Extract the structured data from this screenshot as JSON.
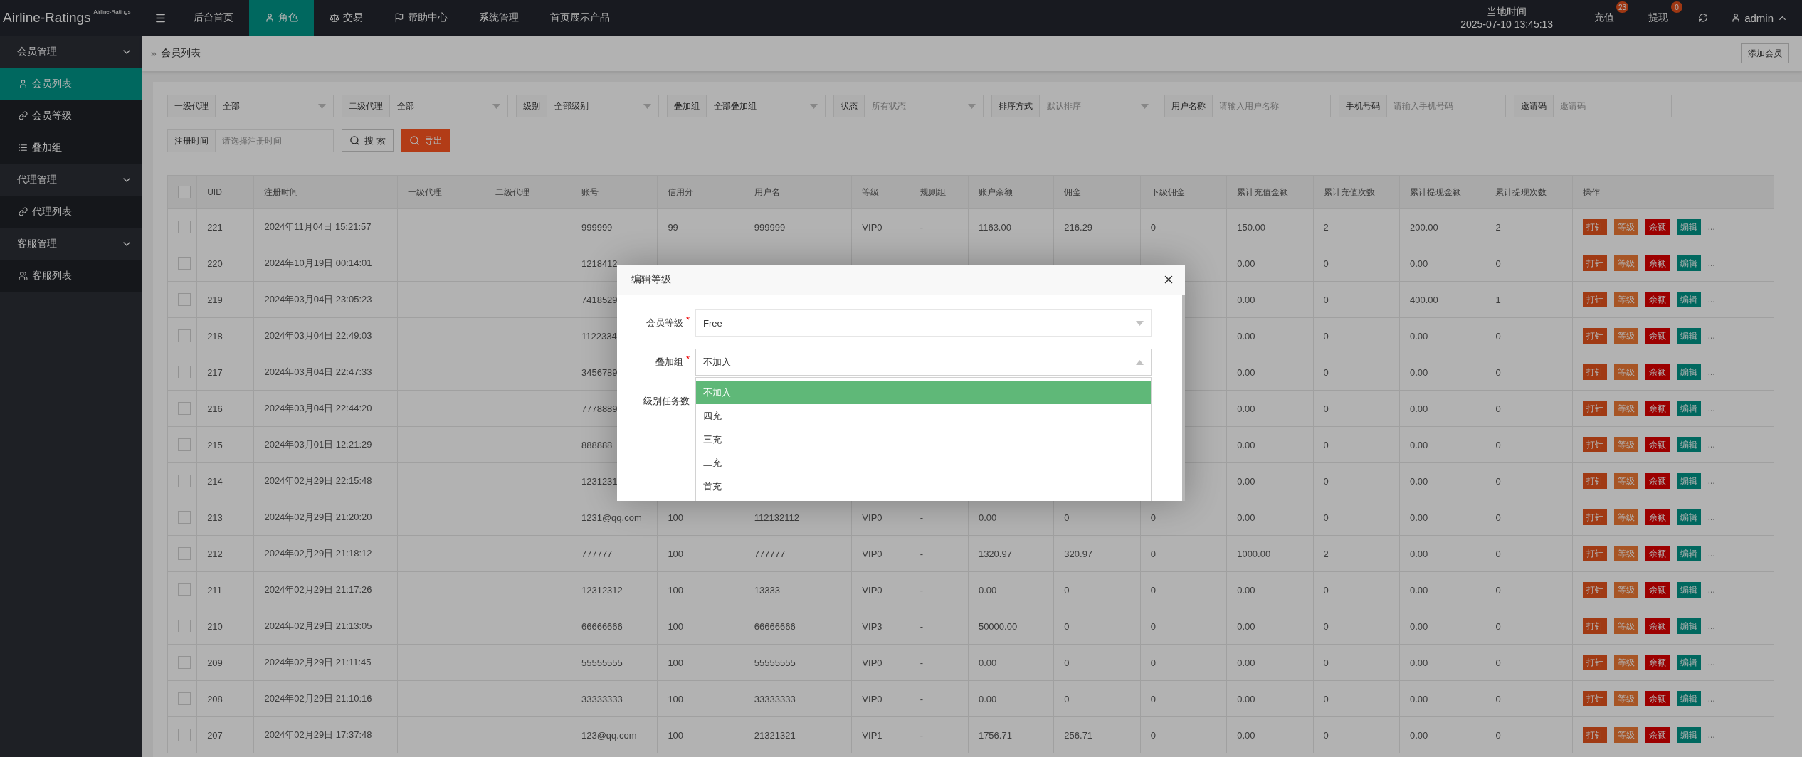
{
  "header": {
    "logo": "Airline-Ratings",
    "logo_sup": "Airline-Ratings",
    "nav": [
      {
        "label": "后台首页",
        "selected": false
      },
      {
        "label": "角色",
        "selected": true
      },
      {
        "label": "交易",
        "selected": false
      },
      {
        "label": "帮助中心",
        "selected": false
      },
      {
        "label": "系统管理",
        "selected": false
      },
      {
        "label": "首页展示产品",
        "selected": false
      }
    ],
    "clock": {
      "label": "当地时间",
      "value": "2025-07-10 13:45:13"
    },
    "counters": [
      {
        "label": "充值",
        "badge": "23"
      },
      {
        "label": "提现",
        "badge": "0"
      }
    ],
    "user": {
      "name": "admin",
      "expanded": true
    }
  },
  "sidebar": {
    "groups": [
      {
        "label": "会员管理",
        "expanded": true,
        "items": [
          {
            "label": "会员列表",
            "selected": true
          },
          {
            "label": "会员等级",
            "selected": false
          },
          {
            "label": "叠加组",
            "selected": false
          }
        ]
      },
      {
        "label": "代理管理",
        "expanded": true,
        "items": [
          {
            "label": "代理列表",
            "selected": false
          }
        ]
      },
      {
        "label": "客服管理",
        "expanded": true,
        "items": [
          {
            "label": "客服列表",
            "selected": false
          }
        ]
      }
    ]
  },
  "breadcrumb": {
    "separator": "»",
    "current": "会员列表",
    "add_button": "添加会员"
  },
  "filters": [
    {
      "kind": "select",
      "label": "一级代理",
      "value": "全部"
    },
    {
      "kind": "select",
      "label": "二级代理",
      "value": "全部"
    },
    {
      "kind": "select",
      "label": "级别",
      "value": "全部级别"
    },
    {
      "kind": "select",
      "label": "叠加组",
      "value": "全部叠加组"
    },
    {
      "kind": "select",
      "label": "状态",
      "placeholder": "所有状态"
    },
    {
      "kind": "select",
      "label": "排序方式",
      "placeholder": "默认排序"
    },
    {
      "kind": "input",
      "label": "用户名称",
      "placeholder": "请输入用户名称"
    },
    {
      "kind": "input",
      "label": "手机号码",
      "placeholder": "请输入手机号码"
    },
    {
      "kind": "input",
      "label": "邀请码",
      "placeholder": "邀请码"
    },
    {
      "kind": "input",
      "label": "注册时间",
      "placeholder": "请选择注册时间"
    }
  ],
  "filter_buttons": [
    {
      "kind": "search",
      "label": "搜 索"
    },
    {
      "kind": "export",
      "label": "导出"
    }
  ],
  "table": {
    "header_checked": false,
    "columns": [
      "UID",
      "注册时间",
      "一级代理",
      "二级代理",
      "账号",
      "信用分",
      "用户名",
      "等级",
      "规则组",
      "账户余额",
      "佣金",
      "下级佣金",
      "累计充值金额",
      "累计充值次数",
      "累计提现金额",
      "累计提现次数",
      "操作"
    ],
    "rows": [
      {
        "checked": false,
        "uid": "221",
        "registered": "2024年11月04日 15:21:57",
        "account": "999999",
        "credit": "99",
        "username": "999999",
        "level": "VIP0",
        "rule_group": "-",
        "balance": "1163.00",
        "commission": "216.29",
        "sub_commission": "0",
        "recharge_total": "150.00",
        "recharge_count": "2",
        "withdraw_total": "200.00",
        "withdraw_count": "2",
        "actions": [
          {
            "kind": "punch",
            "label": "打针"
          },
          {
            "kind": "level",
            "label": "等级"
          },
          {
            "kind": "balance",
            "label": "余额"
          },
          {
            "kind": "edit",
            "label": "编辑"
          }
        ],
        "more": "..."
      },
      {
        "checked": false,
        "uid": "220",
        "registered": "2024年10月19日 00:14:01",
        "account": "1218412",
        "recharge_total": "0.00",
        "recharge_count": "0",
        "withdraw_total": "0.00",
        "withdraw_count": "0",
        "actions": [
          {
            "kind": "punch",
            "label": "打针"
          },
          {
            "kind": "level",
            "label": "等级"
          },
          {
            "kind": "balance",
            "label": "余额"
          },
          {
            "kind": "edit",
            "label": "编辑"
          }
        ],
        "more": "..."
      },
      {
        "checked": false,
        "uid": "219",
        "registered": "2024年03月04日 23:05:23",
        "account": "7418529",
        "recharge_total": "0.00",
        "recharge_count": "0",
        "withdraw_total": "400.00",
        "withdraw_count": "1",
        "actions": [
          {
            "kind": "punch",
            "label": "打针"
          },
          {
            "kind": "level",
            "label": "等级"
          },
          {
            "kind": "balance",
            "label": "余额"
          },
          {
            "kind": "edit",
            "label": "编辑"
          }
        ],
        "more": "..."
      },
      {
        "checked": false,
        "uid": "218",
        "registered": "2024年03月04日 22:49:03",
        "account": "1122334",
        "recharge_total": "0.00",
        "recharge_count": "0",
        "withdraw_total": "0.00",
        "withdraw_count": "0",
        "actions": [
          {
            "kind": "punch",
            "label": "打针"
          },
          {
            "kind": "level",
            "label": "等级"
          },
          {
            "kind": "balance",
            "label": "余额"
          },
          {
            "kind": "edit",
            "label": "编辑"
          }
        ],
        "more": "..."
      },
      {
        "checked": false,
        "uid": "217",
        "registered": "2024年03月04日 22:47:33",
        "account": "3456789",
        "recharge_total": "0.00",
        "recharge_count": "0",
        "withdraw_total": "0.00",
        "withdraw_count": "0",
        "actions": [
          {
            "kind": "punch",
            "label": "打针"
          },
          {
            "kind": "level",
            "label": "等级"
          },
          {
            "kind": "balance",
            "label": "余额"
          },
          {
            "kind": "edit",
            "label": "编辑"
          }
        ],
        "more": "..."
      },
      {
        "checked": false,
        "uid": "216",
        "registered": "2024年03月04日 22:44:20",
        "account": "7778889",
        "recharge_total": "0.00",
        "recharge_count": "0",
        "withdraw_total": "0.00",
        "withdraw_count": "0",
        "actions": [
          {
            "kind": "punch",
            "label": "打针"
          },
          {
            "kind": "level",
            "label": "等级"
          },
          {
            "kind": "balance",
            "label": "余额"
          },
          {
            "kind": "edit",
            "label": "编辑"
          }
        ],
        "more": "..."
      },
      {
        "checked": false,
        "uid": "215",
        "registered": "2024年03月01日 12:21:29",
        "account": "888888",
        "recharge_total": "0.00",
        "recharge_count": "0",
        "withdraw_total": "0.00",
        "withdraw_count": "0",
        "actions": [
          {
            "kind": "punch",
            "label": "打针"
          },
          {
            "kind": "level",
            "label": "等级"
          },
          {
            "kind": "balance",
            "label": "余额"
          },
          {
            "kind": "edit",
            "label": "编辑"
          }
        ],
        "more": "..."
      },
      {
        "checked": false,
        "uid": "214",
        "registered": "2024年02月29日 22:15:48",
        "account": "1231231",
        "recharge_total": "0.00",
        "recharge_count": "0",
        "withdraw_total": "0.00",
        "withdraw_count": "0",
        "actions": [
          {
            "kind": "punch",
            "label": "打针"
          },
          {
            "kind": "level",
            "label": "等级"
          },
          {
            "kind": "balance",
            "label": "余额"
          },
          {
            "kind": "edit",
            "label": "编辑"
          }
        ],
        "more": "..."
      },
      {
        "checked": false,
        "uid": "213",
        "registered": "2024年02月29日 21:20:20",
        "account": "1231@qq.com",
        "credit": "100",
        "username": "112132112",
        "level": "VIP0",
        "rule_group": "-",
        "balance": "0.00",
        "commission": "0",
        "sub_commission": "0",
        "recharge_total": "0.00",
        "recharge_count": "0",
        "withdraw_total": "0.00",
        "withdraw_count": "0",
        "actions": [
          {
            "kind": "punch",
            "label": "打针"
          },
          {
            "kind": "level",
            "label": "等级"
          },
          {
            "kind": "balance",
            "label": "余额"
          },
          {
            "kind": "edit",
            "label": "编辑"
          }
        ],
        "more": "..."
      },
      {
        "checked": false,
        "uid": "212",
        "registered": "2024年02月29日 21:18:12",
        "account": "777777",
        "credit": "100",
        "username": "777777",
        "level": "VIP0",
        "rule_group": "-",
        "balance": "1320.97",
        "commission": "320.97",
        "sub_commission": "0",
        "recharge_total": "1000.00",
        "recharge_count": "2",
        "withdraw_total": "0.00",
        "withdraw_count": "0",
        "actions": [
          {
            "kind": "punch",
            "label": "打针"
          },
          {
            "kind": "level",
            "label": "等级"
          },
          {
            "kind": "balance",
            "label": "余额"
          },
          {
            "kind": "edit",
            "label": "编辑"
          }
        ],
        "more": "..."
      },
      {
        "checked": false,
        "uid": "211",
        "registered": "2024年02月29日 21:17:26",
        "account": "12312312",
        "credit": "100",
        "username": "13333",
        "level": "VIP0",
        "rule_group": "-",
        "balance": "0.00",
        "commission": "0",
        "sub_commission": "0",
        "recharge_total": "0.00",
        "recharge_count": "0",
        "withdraw_total": "0.00",
        "withdraw_count": "0",
        "actions": [
          {
            "kind": "punch",
            "label": "打针"
          },
          {
            "kind": "level",
            "label": "等级"
          },
          {
            "kind": "balance",
            "label": "余额"
          },
          {
            "kind": "edit",
            "label": "编辑"
          }
        ],
        "more": "..."
      },
      {
        "checked": false,
        "uid": "210",
        "registered": "2024年02月29日 21:13:05",
        "account": "66666666",
        "credit": "100",
        "username": "66666666",
        "level": "VIP3",
        "rule_group": "-",
        "balance": "50000.00",
        "commission": "0",
        "sub_commission": "0",
        "recharge_total": "0.00",
        "recharge_count": "0",
        "withdraw_total": "0.00",
        "withdraw_count": "0",
        "actions": [
          {
            "kind": "punch",
            "label": "打针"
          },
          {
            "kind": "level",
            "label": "等级"
          },
          {
            "kind": "balance",
            "label": "余额"
          },
          {
            "kind": "edit",
            "label": "编辑"
          }
        ],
        "more": "..."
      },
      {
        "checked": false,
        "uid": "209",
        "registered": "2024年02月29日 21:11:45",
        "account": "55555555",
        "credit": "100",
        "username": "55555555",
        "level": "VIP0",
        "rule_group": "-",
        "balance": "0.00",
        "commission": "0",
        "sub_commission": "0",
        "recharge_total": "0.00",
        "recharge_count": "0",
        "withdraw_total": "0.00",
        "withdraw_count": "0",
        "actions": [
          {
            "kind": "punch",
            "label": "打针"
          },
          {
            "kind": "level",
            "label": "等级"
          },
          {
            "kind": "balance",
            "label": "余额"
          },
          {
            "kind": "edit",
            "label": "编辑"
          }
        ],
        "more": "..."
      },
      {
        "checked": false,
        "uid": "208",
        "registered": "2024年02月29日 21:10:16",
        "account": "33333333",
        "credit": "100",
        "username": "33333333",
        "level": "VIP0",
        "rule_group": "-",
        "balance": "0.00",
        "commission": "0",
        "sub_commission": "0",
        "recharge_total": "0.00",
        "recharge_count": "0",
        "withdraw_total": "0.00",
        "withdraw_count": "0",
        "actions": [
          {
            "kind": "punch",
            "label": "打针"
          },
          {
            "kind": "level",
            "label": "等级"
          },
          {
            "kind": "balance",
            "label": "余额"
          },
          {
            "kind": "edit",
            "label": "编辑"
          }
        ],
        "more": "..."
      },
      {
        "checked": false,
        "uid": "207",
        "registered": "2024年02月29日 17:37:48",
        "account": "123@qq.com",
        "credit": "100",
        "username": "21321321",
        "level": "VIP1",
        "rule_group": "-",
        "balance": "1756.71",
        "commission": "256.71",
        "sub_commission": "0",
        "recharge_total": "0.00",
        "recharge_count": "0",
        "withdraw_total": "0.00",
        "withdraw_count": "0",
        "actions": [
          {
            "kind": "punch",
            "label": "打针"
          },
          {
            "kind": "level",
            "label": "等级"
          },
          {
            "kind": "balance",
            "label": "余额"
          },
          {
            "kind": "edit",
            "label": "编辑"
          }
        ],
        "more": "..."
      }
    ]
  },
  "modal": {
    "title": "编辑等级",
    "fields": [
      {
        "label": "会员等级",
        "required_mark": "*",
        "value": "Free",
        "open": false
      },
      {
        "label": "叠加组",
        "required_mark": "*",
        "value": "不加入",
        "open": true,
        "options": [
          {
            "label": "不加入",
            "selected": true
          },
          {
            "label": "四充",
            "selected": false
          },
          {
            "label": "三充",
            "selected": false
          },
          {
            "label": "二充",
            "selected": false
          },
          {
            "label": "首充",
            "selected": false
          }
        ]
      },
      {
        "label": "级别任务数"
      }
    ]
  }
}
